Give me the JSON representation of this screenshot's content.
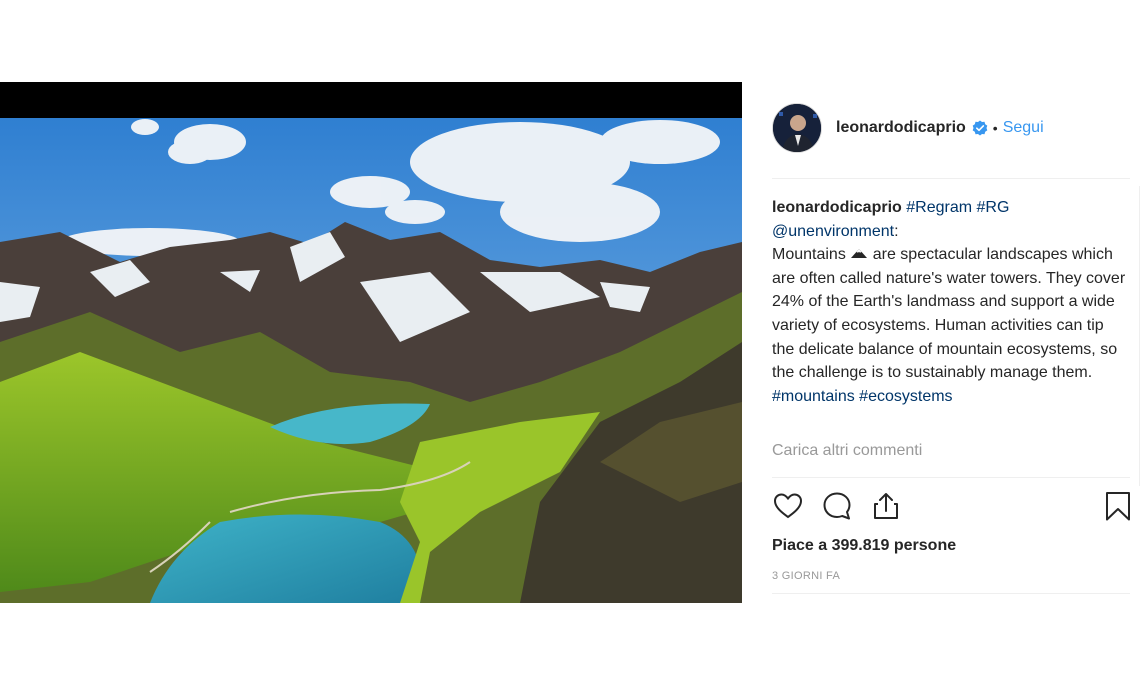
{
  "post": {
    "username": "leonardodicaprio",
    "separator": "•",
    "follow_label": "Segui",
    "caption": {
      "user": "leonardodicaprio",
      "tag1": "#Regram",
      "tag2": "#RG",
      "mention": "@unenvironment",
      "mention_suffix": ":",
      "text_before_icon": "Mountains",
      "text_after_icon": " are spectacular landscapes which are often called nature's water towers. They cover 24% of the Earth's landmass and support a wide variety of ecosystems. Human activities can tip the delicate balance of mountain ecosystems, so the challenge is to sustainably manage them.",
      "tag3": "#mountains",
      "tag4": "#ecosystems"
    },
    "load_more_comments": "Carica altri commenti",
    "likes_text": "Piace a 399.819 persone",
    "timestamp": "3 GIORNI FA"
  },
  "icons": {
    "like": "heart-icon",
    "comment": "comment-icon",
    "share": "share-icon",
    "save": "bookmark-icon",
    "verified": "verified-badge-icon",
    "mountain_emoji": "mountain-icon"
  },
  "colors": {
    "link": "#003569",
    "follow": "#3897f0",
    "muted": "#999999",
    "verified": "#3897f0"
  }
}
